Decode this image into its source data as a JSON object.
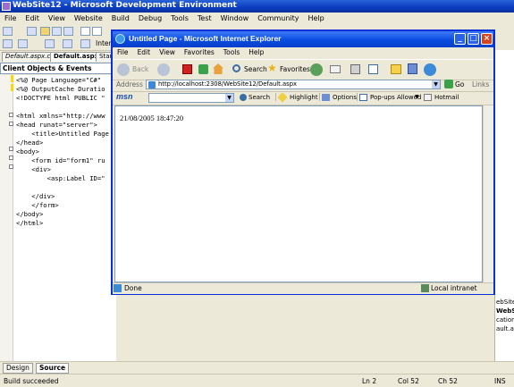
{
  "vs": {
    "title": "WebSite12 - Microsoft Development Environment",
    "menu": [
      "File",
      "Edit",
      "View",
      "Website",
      "Build",
      "Debug",
      "Tools",
      "Test",
      "Window",
      "Community",
      "Help"
    ],
    "toolbar_partial": "Interr",
    "tabs": [
      "Default.aspx.cs",
      "Default.aspx*",
      "Start"
    ],
    "combo": "Client Objects & Events",
    "code_lines": [
      "<%@ Page Language=\"C#\"",
      "<%@ OutputCache Duratio",
      "<!DOCTYPE html PUBLIC \"",
      "",
      "<html xmlns=\"http://www",
      "<head runat=\"server\">",
      "    <title>Untitled Page",
      "</head>",
      "<body>",
      "    <form id=\"form1\" ru",
      "    <div>",
      "        <asp:Label ID=\"",
      "",
      "    </div>",
      "    </form>",
      "</body>",
      "</html>"
    ],
    "right_panel": [
      "ebSite12",
      "WebSite",
      "cation_",
      "ault.aspx"
    ],
    "design_tab": "Design",
    "source_tab": "Source",
    "status": {
      "message": "Build succeeded",
      "ln": "Ln 2",
      "col": "Col 52",
      "ch": "Ch 52",
      "ins": "INS"
    }
  },
  "ie": {
    "title": "Untitled Page - Microsoft Internet Explorer",
    "menu": [
      "File",
      "Edit",
      "View",
      "Favorites",
      "Tools",
      "Help"
    ],
    "back": "Back",
    "search": "Search",
    "favorites": "Favorites",
    "address_label": "Address",
    "url": "http://localhost:2308/WebSite12/Default.aspx",
    "go": "Go",
    "links": "Links",
    "msn": "msn",
    "msn_search": "Search",
    "highlight": "Highlight",
    "options": "Options",
    "popups": "Pop-ups Allowed",
    "hotmail": "Hotmail",
    "page_text": "21/08/2005 18:47:20",
    "status": "Done",
    "zone": "Local intranet"
  },
  "colors": {
    "title_blue": "#0a3cc0",
    "ie_border": "#0831d9",
    "close_red": "#d9431f"
  }
}
